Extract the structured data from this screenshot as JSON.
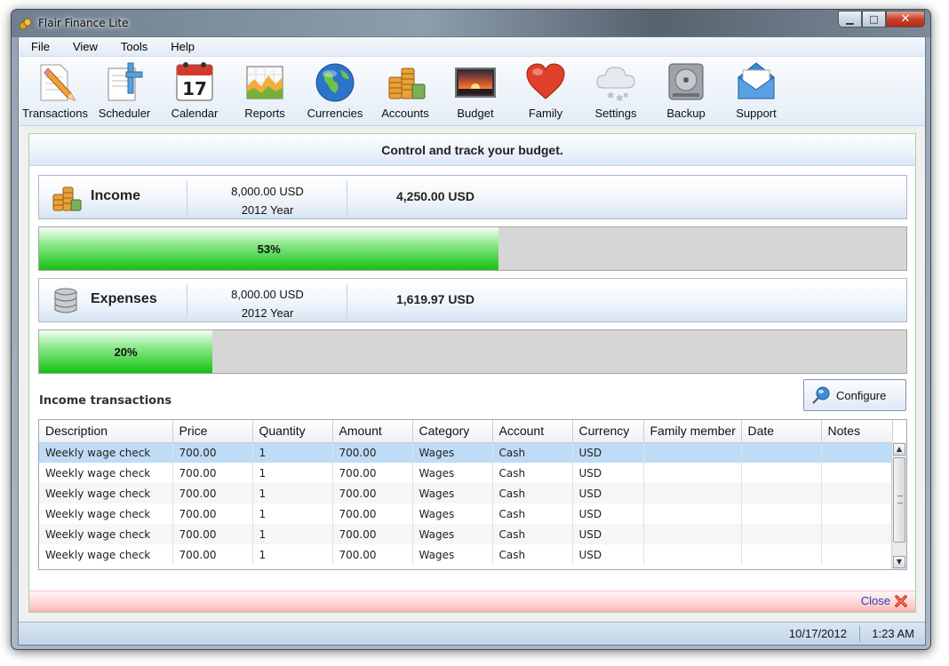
{
  "window": {
    "title": "Flair Finance Lite"
  },
  "menu": {
    "items": [
      "File",
      "View",
      "Tools",
      "Help"
    ]
  },
  "toolbar": {
    "items": [
      {
        "label": "Transactions",
        "icon": "pencil-notepad-icon"
      },
      {
        "label": "Scheduler",
        "icon": "scheduler-document-icon"
      },
      {
        "label": "Calendar",
        "icon": "calendar-icon",
        "day": "17"
      },
      {
        "label": "Reports",
        "icon": "chart-icon"
      },
      {
        "label": "Currencies",
        "icon": "globe-icon"
      },
      {
        "label": "Accounts",
        "icon": "coins-icon"
      },
      {
        "label": "Budget",
        "icon": "sunset-picture-icon"
      },
      {
        "label": "Family",
        "icon": "heart-icon"
      },
      {
        "label": "Settings",
        "icon": "snow-cloud-icon"
      },
      {
        "label": "Backup",
        "icon": "hard-drive-icon"
      },
      {
        "label": "Support",
        "icon": "envelope-icon"
      }
    ]
  },
  "panel": {
    "header": "Control and track your budget.",
    "income": {
      "name": "Income",
      "planned": "8,000.00 USD",
      "period": "2012 Year",
      "actual": "4,250.00 USD",
      "percent_label": "53%",
      "percent": 53
    },
    "expenses": {
      "name": "Expenses",
      "planned": "8,000.00 USD",
      "period": "2012 Year",
      "actual": "1,619.97 USD",
      "percent_label": "20%",
      "percent": 20
    },
    "section_title": "Income transactions",
    "configure_label": "Configure",
    "close_label": "Close"
  },
  "table": {
    "columns": [
      "Description",
      "Price",
      "Quantity",
      "Amount",
      "Category",
      "Account",
      "Currency",
      "Family member",
      "Date",
      "Notes"
    ],
    "rows": [
      [
        "Weekly wage check",
        "700.00",
        "1",
        "700.00",
        "Wages",
        "Cash",
        "USD",
        "",
        "",
        ""
      ],
      [
        "Weekly wage check",
        "700.00",
        "1",
        "700.00",
        "Wages",
        "Cash",
        "USD",
        "",
        "",
        ""
      ],
      [
        "Weekly wage check",
        "700.00",
        "1",
        "700.00",
        "Wages",
        "Cash",
        "USD",
        "",
        "",
        ""
      ],
      [
        "Weekly wage check",
        "700.00",
        "1",
        "700.00",
        "Wages",
        "Cash",
        "USD",
        "",
        "",
        ""
      ],
      [
        "Weekly wage check",
        "700.00",
        "1",
        "700.00",
        "Wages",
        "Cash",
        "USD",
        "",
        "",
        ""
      ],
      [
        "Weekly wage check",
        "700.00",
        "1",
        "700.00",
        "Wages",
        "Cash",
        "USD",
        "",
        "",
        ""
      ]
    ]
  },
  "status": {
    "date": "10/17/2012",
    "time": "1:23 AM"
  },
  "colors": {
    "progress_green": "#13c213",
    "selected_row": "#bfdcf6",
    "close_link": "#2b3db8"
  }
}
